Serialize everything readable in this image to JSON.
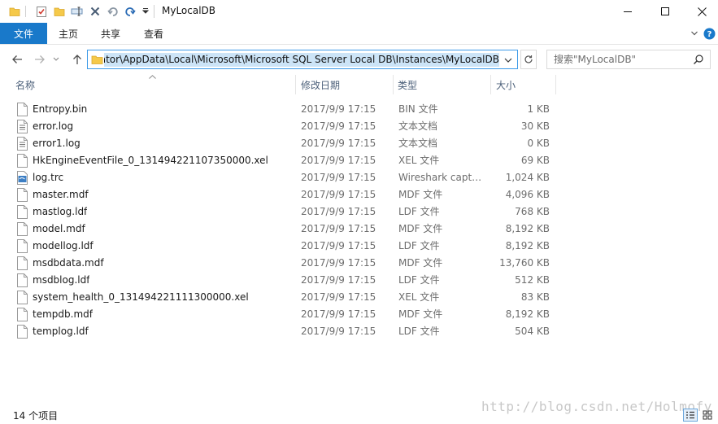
{
  "window": {
    "title": "MyLocalDB"
  },
  "ribbon": {
    "file_tab": "文件",
    "tabs": [
      "主页",
      "共享",
      "查看"
    ]
  },
  "nav": {
    "address_path": "...ator\\AppData\\Local\\Microsoft\\Microsoft SQL Server Local DB\\Instances\\MyLocalDB",
    "search_placeholder": "搜索\"MyLocalDB\""
  },
  "columns": {
    "name": "名称",
    "date": "修改日期",
    "type": "类型",
    "size": "大小"
  },
  "files": [
    {
      "name": "Entropy.bin",
      "date": "2017/9/9 17:15",
      "type": "BIN 文件",
      "size": "1 KB",
      "icon": "file-icon"
    },
    {
      "name": "error.log",
      "date": "2017/9/9 17:15",
      "type": "文本文档",
      "size": "30 KB",
      "icon": "text-file-icon"
    },
    {
      "name": "error1.log",
      "date": "2017/9/9 17:15",
      "type": "文本文档",
      "size": "0 KB",
      "icon": "text-file-icon"
    },
    {
      "name": "HkEngineEventFile_0_131494221107350000.xel",
      "date": "2017/9/9 17:15",
      "type": "XEL 文件",
      "size": "69 KB",
      "icon": "file-icon"
    },
    {
      "name": "log.trc",
      "date": "2017/9/9 17:15",
      "type": "Wireshark captu...",
      "size": "1,024 KB",
      "icon": "wireshark-file-icon"
    },
    {
      "name": "master.mdf",
      "date": "2017/9/9 17:15",
      "type": "MDF 文件",
      "size": "4,096 KB",
      "icon": "file-icon"
    },
    {
      "name": "mastlog.ldf",
      "date": "2017/9/9 17:15",
      "type": "LDF 文件",
      "size": "768 KB",
      "icon": "file-icon"
    },
    {
      "name": "model.mdf",
      "date": "2017/9/9 17:15",
      "type": "MDF 文件",
      "size": "8,192 KB",
      "icon": "file-icon"
    },
    {
      "name": "modellog.ldf",
      "date": "2017/9/9 17:15",
      "type": "LDF 文件",
      "size": "8,192 KB",
      "icon": "file-icon"
    },
    {
      "name": "msdbdata.mdf",
      "date": "2017/9/9 17:15",
      "type": "MDF 文件",
      "size": "13,760 KB",
      "icon": "file-icon"
    },
    {
      "name": "msdblog.ldf",
      "date": "2017/9/9 17:15",
      "type": "LDF 文件",
      "size": "512 KB",
      "icon": "file-icon"
    },
    {
      "name": "system_health_0_131494221111300000.xel",
      "date": "2017/9/9 17:15",
      "type": "XEL 文件",
      "size": "83 KB",
      "icon": "file-icon"
    },
    {
      "name": "tempdb.mdf",
      "date": "2017/9/9 17:15",
      "type": "MDF 文件",
      "size": "8,192 KB",
      "icon": "file-icon"
    },
    {
      "name": "templog.ldf",
      "date": "2017/9/9 17:15",
      "type": "LDF 文件",
      "size": "504 KB",
      "icon": "file-icon"
    }
  ],
  "status": {
    "item_count": "14 个项目",
    "watermark": "http://blog.csdn.net/Holmofy"
  },
  "colors": {
    "accent": "#1979ca",
    "address_border": "#3c9ae8",
    "selection": "#cce4f7",
    "header_text": "#4c607a"
  }
}
